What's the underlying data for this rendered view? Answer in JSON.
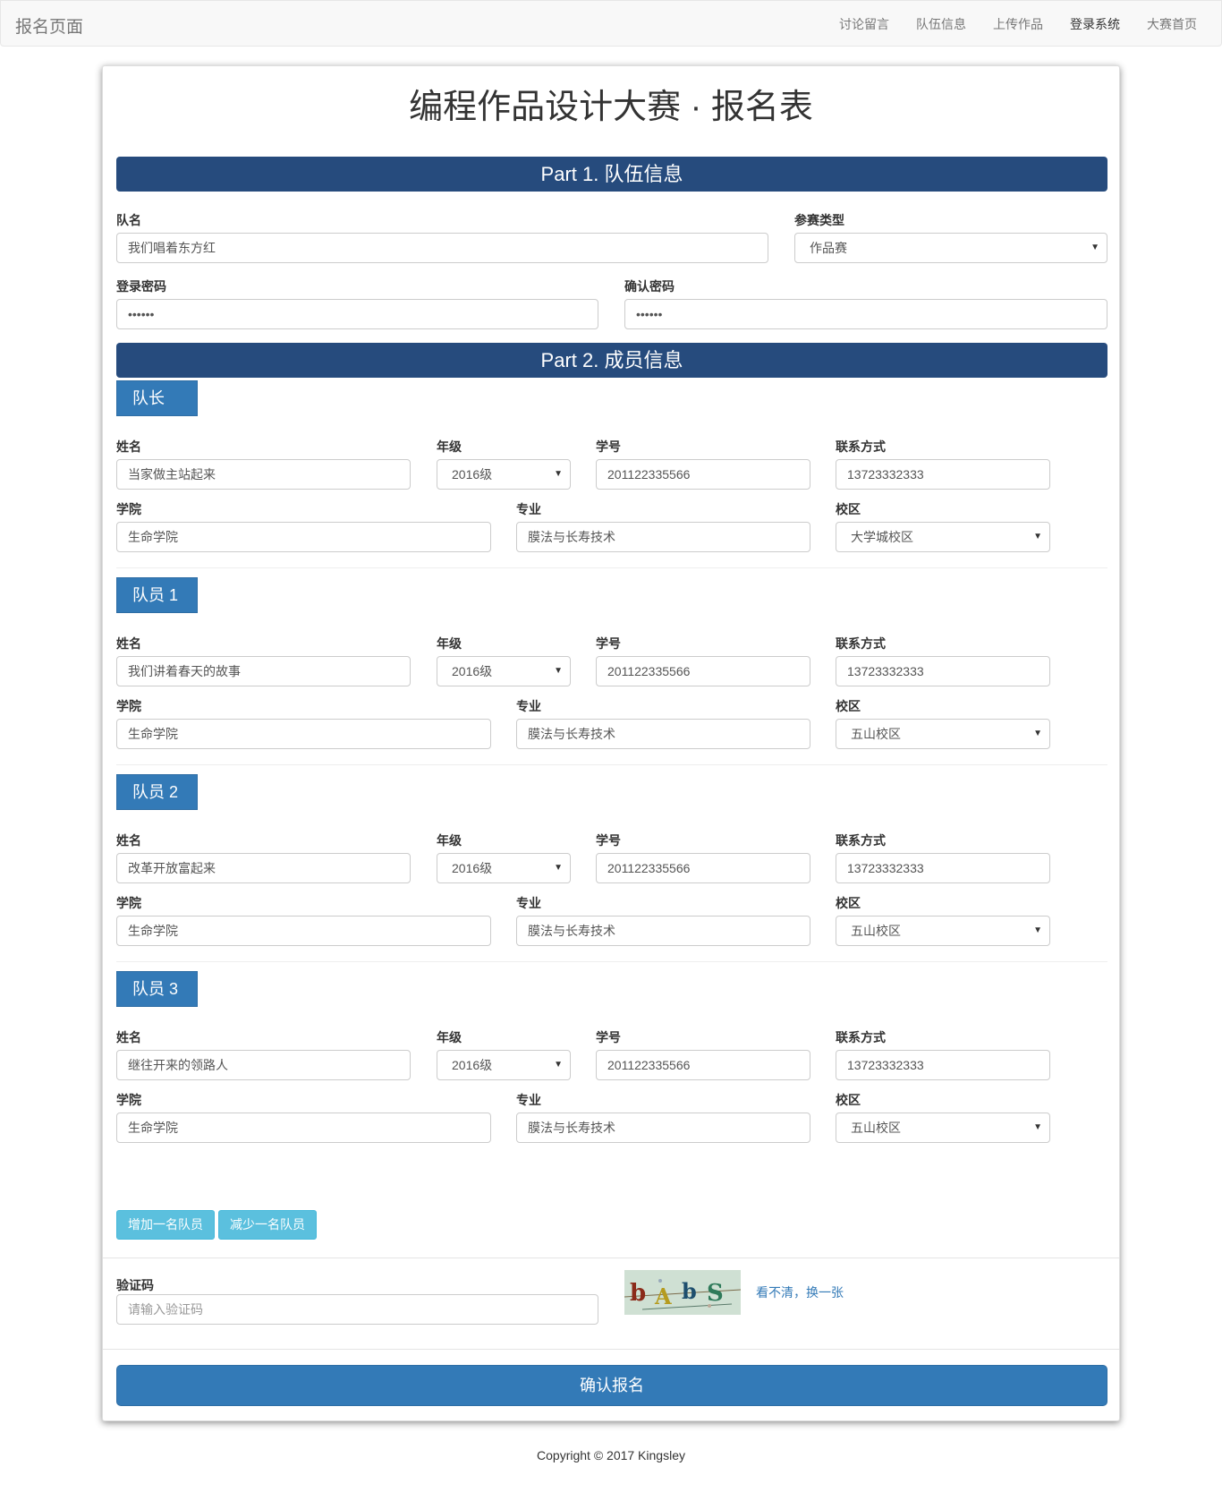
{
  "navbar": {
    "brand": "报名页面",
    "items": [
      {
        "label": "讨论留言"
      },
      {
        "label": "队伍信息"
      },
      {
        "label": "上传作品"
      },
      {
        "label": "登录系统"
      },
      {
        "label": "大赛首页"
      }
    ],
    "active_item": "登录系统"
  },
  "form": {
    "title": "编程作品设计大赛 · 报名表",
    "part1": {
      "heading": "Part 1. 队伍信息",
      "team_name": {
        "label": "队名",
        "value": "我们唱着东方红"
      },
      "entry_type": {
        "label": "参赛类型",
        "value": "作品赛"
      },
      "password": {
        "label": "登录密码",
        "value": "••••••"
      },
      "confirm_password": {
        "label": "确认密码",
        "value": "••••••"
      }
    },
    "part2": {
      "heading": "Part 2. 成员信息",
      "field_labels": {
        "name": "姓名",
        "grade": "年级",
        "student_id": "学号",
        "contact": "联系方式",
        "college": "学院",
        "major": "专业",
        "campus": "校区"
      },
      "members": [
        {
          "role": "队长",
          "name": "当家做主站起来",
          "grade": "2016级",
          "student_id": "201122335566",
          "contact": "13723332333",
          "college": "生命学院",
          "major": "膜法与长寿技术",
          "campus": "大学城校区"
        },
        {
          "role": "队员 1",
          "name": "我们讲着春天的故事",
          "grade": "2016级",
          "student_id": "201122335566",
          "contact": "13723332333",
          "college": "生命学院",
          "major": "膜法与长寿技术",
          "campus": "五山校区"
        },
        {
          "role": "队员 2",
          "name": "改革开放富起来",
          "grade": "2016级",
          "student_id": "201122335566",
          "contact": "13723332333",
          "college": "生命学院",
          "major": "膜法与长寿技术",
          "campus": "五山校区"
        },
        {
          "role": "队员 3",
          "name": "继往开来的领路人",
          "grade": "2016级",
          "student_id": "201122335566",
          "contact": "13723332333",
          "college": "生命学院",
          "major": "膜法与长寿技术",
          "campus": "五山校区"
        }
      ],
      "add_member_label": "增加一名队员",
      "remove_member_label": "减少一名队员"
    },
    "captcha": {
      "label": "验证码",
      "placeholder": "请输入验证码",
      "image_text": "bAbS",
      "refresh_label": "看不清，换一张"
    },
    "submit_label": "确认报名"
  },
  "footer": {
    "copyright": "Copyright © 2017 Kingsley"
  },
  "colors": {
    "part_bar": "#264b7d",
    "primary": "#337ab7",
    "info": "#5bc0de",
    "navbar_bg": "#f8f8f8"
  }
}
